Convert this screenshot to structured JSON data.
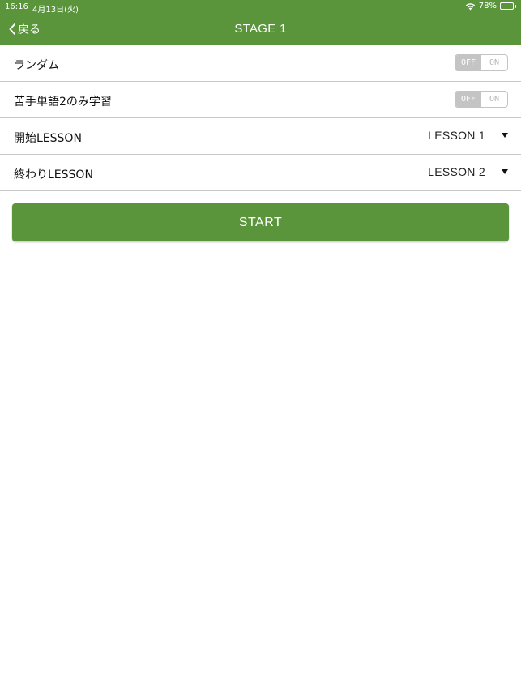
{
  "status_bar": {
    "time": "16:16",
    "date": "4月13日(火)",
    "battery": "78%",
    "battery_level": 0.78
  },
  "nav": {
    "back_label": "戻る",
    "title": "STAGE 1"
  },
  "settings": {
    "random": {
      "label": "ランダム",
      "off_label": "OFF",
      "on_label": "ON",
      "state": "off"
    },
    "weak_words": {
      "label": "苦手単語2のみ学習",
      "off_label": "OFF",
      "on_label": "ON",
      "state": "off"
    },
    "start_lesson": {
      "label": "開始LESSON",
      "value": "LESSON 1"
    },
    "end_lesson": {
      "label": "終わりLESSON",
      "value": "LESSON 2"
    }
  },
  "start_button": {
    "label": "START"
  },
  "colors": {
    "header_bg": "#5a943b",
    "button_bg": "#5a943b",
    "toggle_off_bg": "#c4c4c4",
    "divider": "#c9c9c9"
  }
}
